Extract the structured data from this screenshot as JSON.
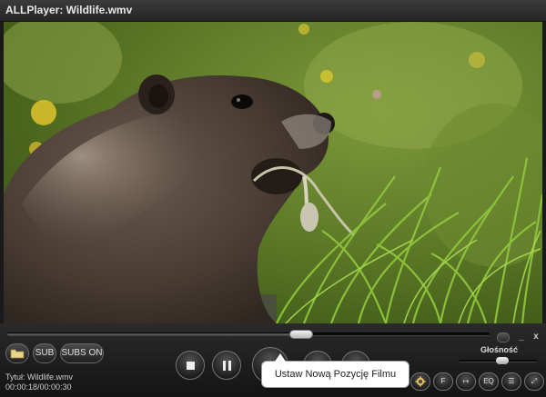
{
  "window": {
    "title": "ALLPlayer: Wildlife.wmv",
    "minimize_label": "_",
    "close_label": "x"
  },
  "video": {
    "content": "marmot-eating-grass"
  },
  "seek": {
    "position": 0.61
  },
  "buttons": {
    "open_icon": "folder-icon",
    "sub_label": "SUB",
    "subs_on_label": "SUBS ON",
    "stop_icon": "stop-icon",
    "pause_icon": "pause-icon",
    "settings_icon": "gear-icon",
    "f_label": "F",
    "redirect_icon": "arrow-right-icon",
    "eq_label": "EQ",
    "playlist_icon": "list-icon",
    "fullscreen_icon": "fullscreen-icon"
  },
  "info": {
    "title_line": "Tytuł: Wildlife.wmv",
    "time_line": "00:00:18/00:00:30"
  },
  "volume": {
    "label": "Głośność",
    "level": 0.55
  },
  "tooltip": {
    "text": "Ustaw Nową Pozycję Filmu"
  }
}
